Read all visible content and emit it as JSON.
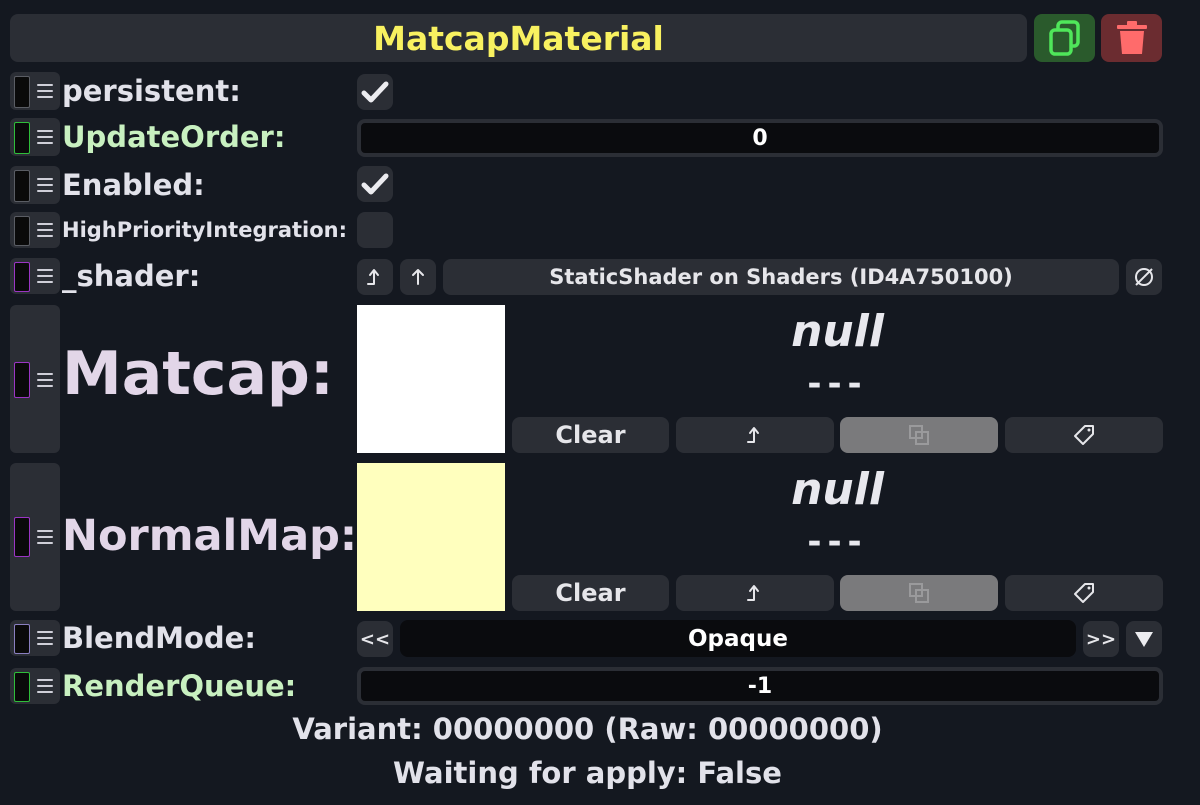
{
  "header": {
    "title": "MatcapMaterial",
    "duplicate_icon": "duplicate-icon",
    "delete_icon": "trash-icon",
    "colors": {
      "title": "#f8f160",
      "duplicate": "#2a5a2c",
      "delete": "#6b2c30"
    }
  },
  "fields": {
    "persistent": {
      "label": "persistent:",
      "checked": true
    },
    "update_order": {
      "label": "UpdateOrder:",
      "value": "0"
    },
    "enabled": {
      "label": "Enabled:",
      "checked": true
    },
    "high_priority": {
      "label": "HighPriorityIntegration:",
      "checked": false
    },
    "shader": {
      "label": "_shader:",
      "value": "StaticShader on Shaders (ID4A750100)",
      "jump_icon": "jump-icon",
      "up_icon": "arrow-up-icon",
      "clear_icon": "null-set-icon"
    },
    "matcap": {
      "label": "Matcap:",
      "preview_color": "#ffffff",
      "null_text": "null",
      "dash_text": "---",
      "clear_label": "Clear"
    },
    "normal_map": {
      "label": "NormalMap:",
      "preview_color": "#ffffbe",
      "null_text": "null",
      "dash_text": "---",
      "clear_label": "Clear"
    },
    "blend_mode": {
      "label": "BlendMode:",
      "value": "Opaque",
      "prev_label": "<<",
      "next_label": ">>",
      "dropdown_icon": "triangle-down-icon"
    },
    "render_queue": {
      "label": "RenderQueue:",
      "value": "-1"
    }
  },
  "footer": {
    "variant": "Variant: 00000000 (Raw: 00000000)",
    "waiting": "Waiting for apply: False"
  }
}
